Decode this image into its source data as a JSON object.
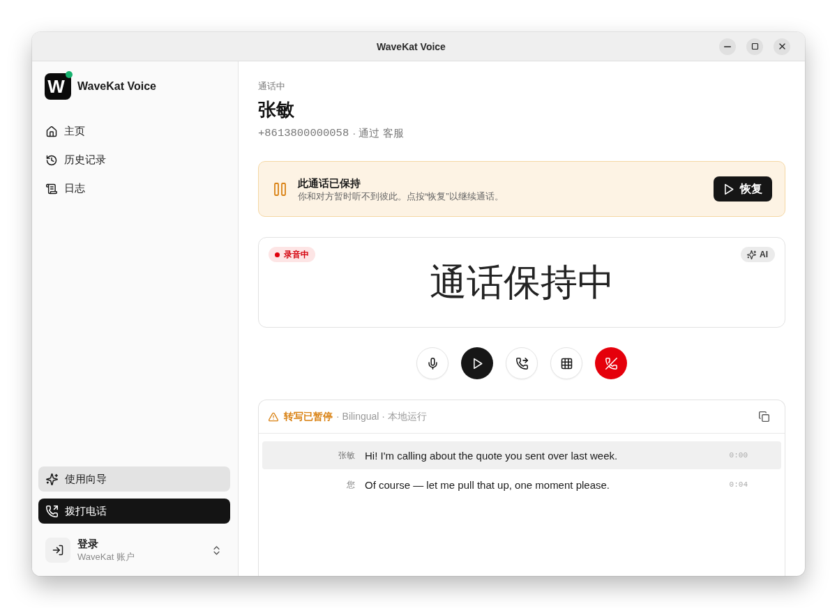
{
  "window": {
    "title": "WaveKat Voice"
  },
  "sidebar": {
    "app_name": "WaveKat Voice",
    "logo_mark": "W",
    "nav": [
      {
        "label": "主页",
        "kind": "home"
      },
      {
        "label": "历史记录",
        "kind": "history"
      },
      {
        "label": "日志",
        "kind": "log"
      }
    ],
    "actions": [
      {
        "label": "使用向导",
        "kind": "guide"
      },
      {
        "label": "拨打电话",
        "kind": "dial"
      }
    ],
    "account": {
      "title": "登录",
      "subtitle": "WaveKat 账户"
    }
  },
  "call": {
    "status": "通话中",
    "name": "张敏",
    "phone": "+8613800000058",
    "via": "· 通过 客服"
  },
  "hold_banner": {
    "title": "此通话已保持",
    "message": "你和对方暂时听不到彼此。点按“恢复”以继续通话。",
    "button": "恢复"
  },
  "caption": {
    "recording": {
      "label": "录音中"
    },
    "ai": {
      "label": "AI"
    },
    "text": "通话保持中"
  },
  "controls": [
    {
      "kind": "mic"
    },
    {
      "kind": "resume"
    },
    {
      "kind": "transfer"
    },
    {
      "kind": "keypad"
    },
    {
      "kind": "hangup"
    }
  ],
  "transcript": {
    "status": "转写已暂停",
    "meta": "· Bilingual · 本地运行",
    "lines": [
      {
        "speaker": "张敏",
        "text": "Hi! I'm calling about the quote you sent over last week.",
        "time": "0:00",
        "selected": true
      },
      {
        "speaker": "您",
        "text": "Of course — let me pull that up, one moment please.",
        "time": "0:04",
        "selected": false
      }
    ]
  }
}
